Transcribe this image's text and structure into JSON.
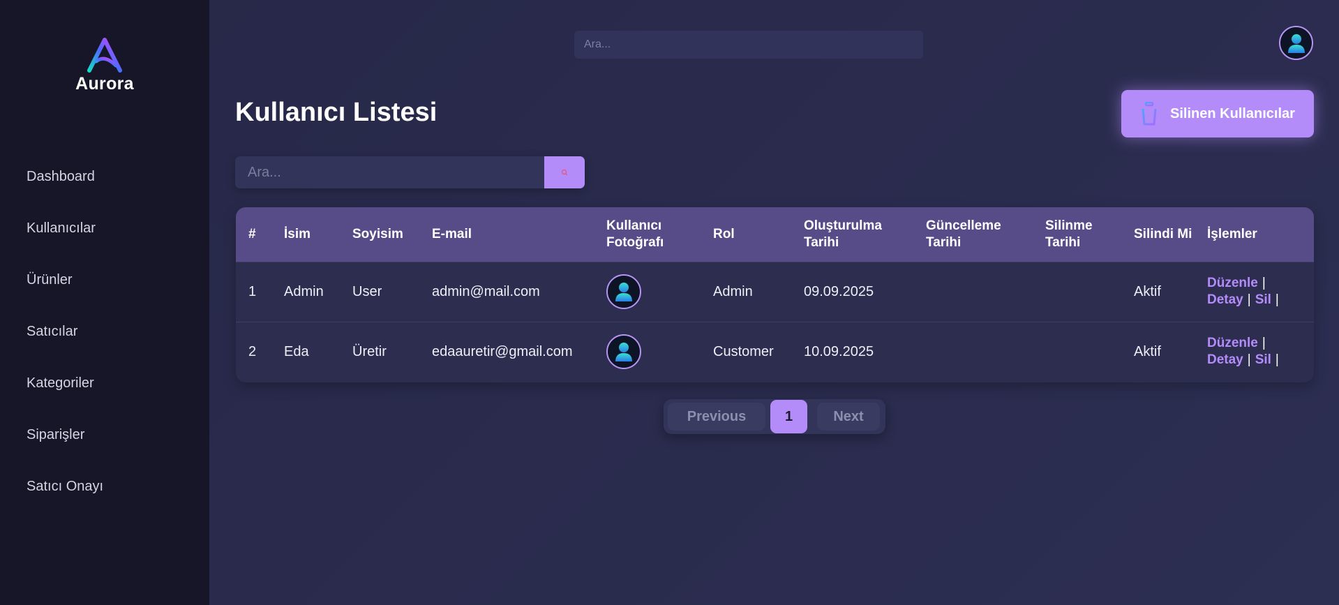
{
  "brand": {
    "name": "Aurora"
  },
  "sidebar": {
    "items": [
      {
        "label": "Dashboard"
      },
      {
        "label": "Kullanıcılar"
      },
      {
        "label": "Ürünler"
      },
      {
        "label": "Satıcılar"
      },
      {
        "label": "Kategoriler"
      },
      {
        "label": "Siparişler"
      },
      {
        "label": "Satıcı Onayı"
      }
    ]
  },
  "header": {
    "search_placeholder": "Ara..."
  },
  "page": {
    "title": "Kullanıcı Listesi",
    "deleted_users_label": "Silinen Kullanıcılar",
    "search_placeholder": "Ara..."
  },
  "table": {
    "columns": [
      "#",
      "İsim",
      "Soyisim",
      "E-mail",
      "Kullanıcı Fotoğrafı",
      "Rol",
      "Oluşturulma Tarihi",
      "Güncelleme Tarihi",
      "Silinme Tarihi",
      "Silindi Mi",
      "İşlemler"
    ],
    "rows": [
      {
        "id": "1",
        "first_name": "Admin",
        "last_name": "User",
        "email": "admin@mail.com",
        "role": "Admin",
        "created": "09.09.2025",
        "updated": "",
        "deleted_at": "",
        "status": "Aktif"
      },
      {
        "id": "2",
        "first_name": "Eda",
        "last_name": "Üretir",
        "email": "edaauretir@gmail.com",
        "role": "Customer",
        "created": "10.09.2025",
        "updated": "",
        "deleted_at": "",
        "status": "Aktif"
      }
    ],
    "actions": {
      "edit": "Düzenle",
      "detail": "Detay",
      "delete": "Sil",
      "separator": "|"
    }
  },
  "pagination": {
    "previous": "Previous",
    "current_page": "1",
    "next": "Next"
  },
  "colors": {
    "accent": "#b48cfa",
    "sidebar_bg": "#161628",
    "page_bg": "#292a4b",
    "table_header_bg": "#574c88"
  },
  "icons": {
    "logo": "aurora-a-logo-icon",
    "avatar": "user-avatar-icon",
    "trash": "trash-icon",
    "search": "search-icon"
  }
}
